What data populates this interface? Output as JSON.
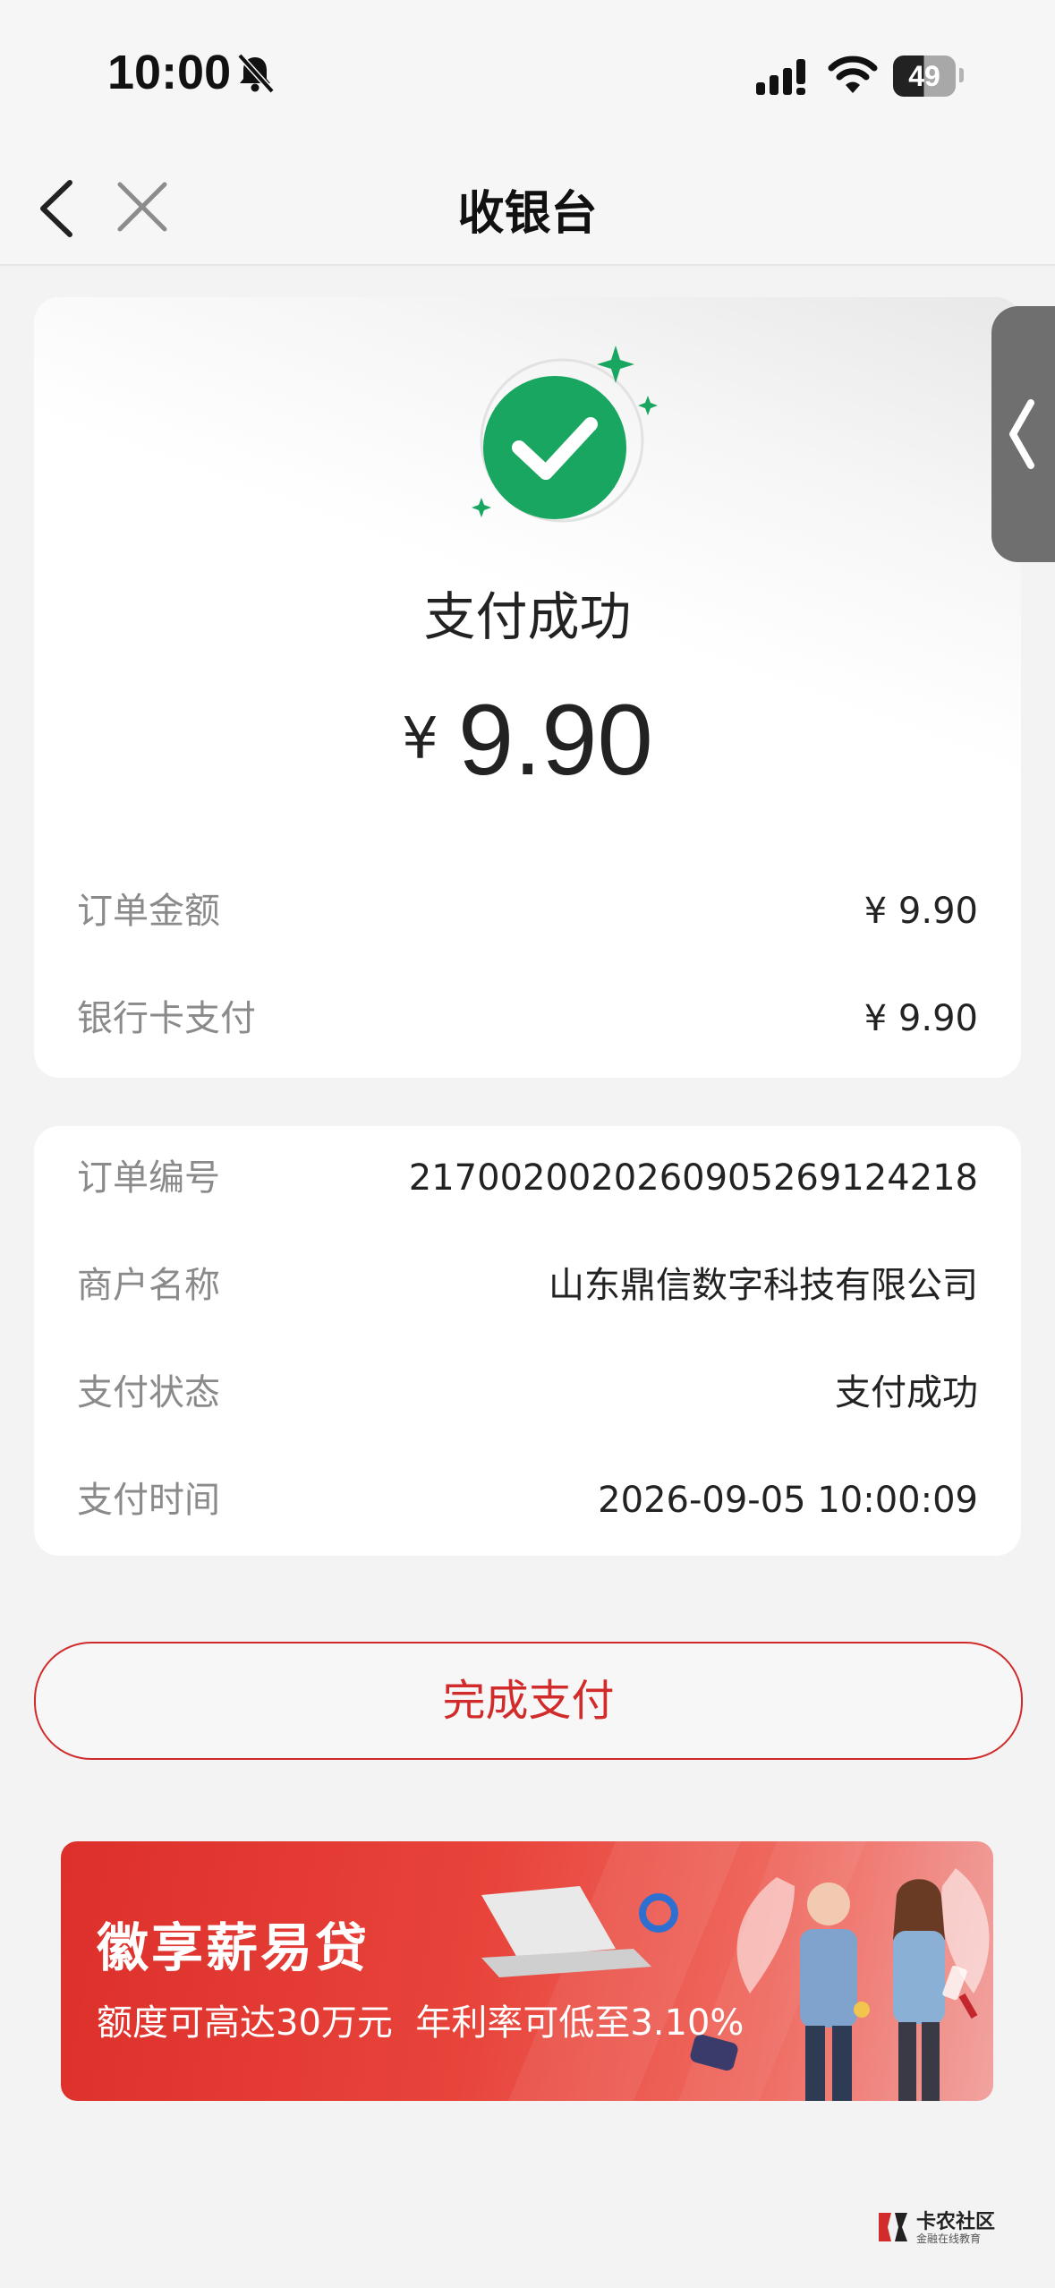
{
  "status_bar": {
    "time": "10:00",
    "battery": "49"
  },
  "nav": {
    "title": "收银台"
  },
  "result": {
    "status_title": "支付成功",
    "currency_symbol": "¥",
    "amount": "9.90",
    "colors": {
      "success_green": "#18a660"
    }
  },
  "summary": [
    {
      "label": "订单金额",
      "value": "¥ 9.90"
    },
    {
      "label": "银行卡支付",
      "value": "¥ 9.90"
    }
  ],
  "details": [
    {
      "label": "订单编号",
      "value": "2170020020260905269124218"
    },
    {
      "label": "商户名称",
      "value": "山东鼎信数字科技有限公司"
    },
    {
      "label": "支付状态",
      "value": "支付成功"
    },
    {
      "label": "支付时间",
      "value": "2026-09-05 10:00:09"
    }
  ],
  "done_button": {
    "label": "完成支付",
    "color": "#d12b2b"
  },
  "banner": {
    "title": "徽享薪易贷",
    "subtitle": "额度可高达30万元  年利率可低至3.10%"
  },
  "watermark": {
    "title": "卡农社区",
    "subtitle": "金融在线教育"
  }
}
